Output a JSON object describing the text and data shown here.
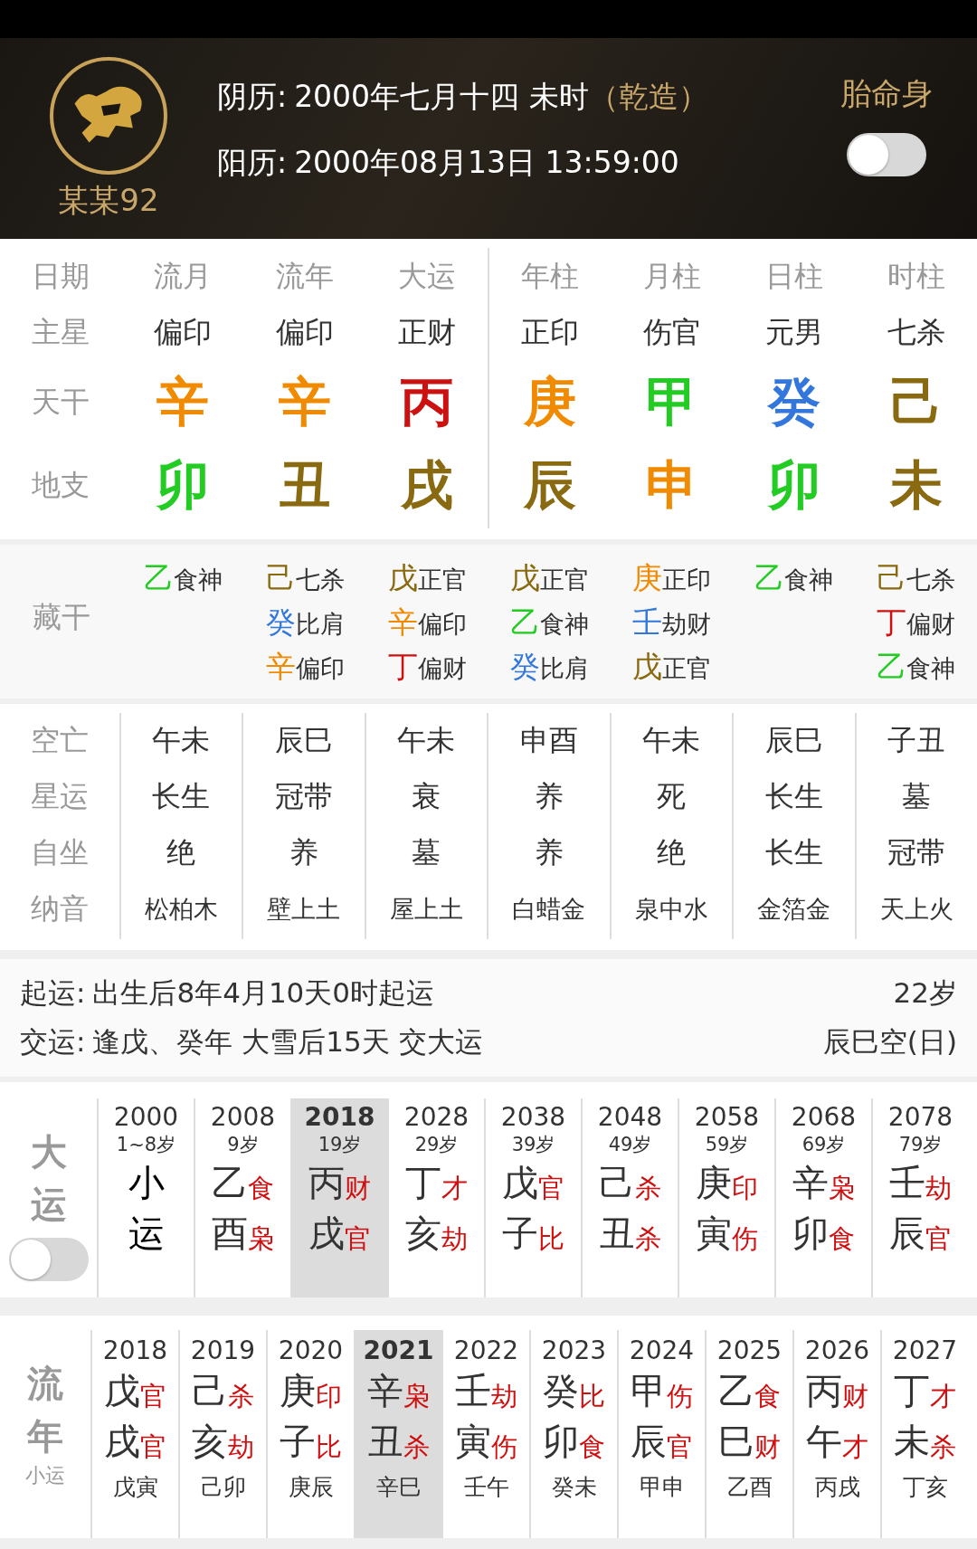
{
  "profile": {
    "name": "某某92"
  },
  "birth": [
    {
      "label": "阴历:",
      "value": "2000年七月十四 未时",
      "tag": "（乾造）"
    },
    {
      "label": "阳历:",
      "value": "2000年08月13日 13:59:00"
    }
  ],
  "taimingshen": {
    "label": "胎命身",
    "on": false
  },
  "pillars": {
    "corner": "日期",
    "row_labels": [
      "主星",
      "天干",
      "地支"
    ],
    "columns": [
      {
        "title": "流月",
        "star": "偏印",
        "stem": {
          "text": "辛",
          "color": "#f08a00"
        },
        "branch": {
          "text": "卯",
          "color": "#22cc22"
        }
      },
      {
        "title": "流年",
        "star": "偏印",
        "stem": {
          "text": "辛",
          "color": "#f08a00"
        },
        "branch": {
          "text": "丑",
          "color": "#8a6a10"
        }
      },
      {
        "title": "大运",
        "star": "正财",
        "stem": {
          "text": "丙",
          "color": "#cc1111"
        },
        "branch": {
          "text": "戌",
          "color": "#8a6a10"
        }
      },
      {
        "title": "年柱",
        "star": "正印",
        "stem": {
          "text": "庚",
          "color": "#f08a00"
        },
        "branch": {
          "text": "辰",
          "color": "#8a6a10"
        }
      },
      {
        "title": "月柱",
        "star": "伤官",
        "stem": {
          "text": "甲",
          "color": "#22cc22"
        },
        "branch": {
          "text": "申",
          "color": "#f08a00"
        }
      },
      {
        "title": "日柱",
        "star": "元男",
        "stem": {
          "text": "癸",
          "color": "#3377dd"
        },
        "branch": {
          "text": "卯",
          "color": "#22cc22"
        }
      },
      {
        "title": "时柱",
        "star": "七杀",
        "stem": {
          "text": "己",
          "color": "#8a6a10"
        },
        "branch": {
          "text": "未",
          "color": "#8a6a10"
        }
      }
    ]
  },
  "canggan": {
    "label": "藏干",
    "columns": [
      [
        {
          "stem": "乙",
          "color": "#22cc22",
          "god": "食神"
        }
      ],
      [
        {
          "stem": "己",
          "color": "#8a6a10",
          "god": "七杀"
        },
        {
          "stem": "癸",
          "color": "#3377dd",
          "god": "比肩"
        },
        {
          "stem": "辛",
          "color": "#f08a00",
          "god": "偏印"
        }
      ],
      [
        {
          "stem": "戊",
          "color": "#8a6a10",
          "god": "正官"
        },
        {
          "stem": "辛",
          "color": "#f08a00",
          "god": "偏印"
        },
        {
          "stem": "丁",
          "color": "#cc1111",
          "god": "偏财"
        }
      ],
      [
        {
          "stem": "戊",
          "color": "#8a6a10",
          "god": "正官"
        },
        {
          "stem": "乙",
          "color": "#22cc22",
          "god": "食神"
        },
        {
          "stem": "癸",
          "color": "#3377dd",
          "god": "比肩"
        }
      ],
      [
        {
          "stem": "庚",
          "color": "#f08a00",
          "god": "正印"
        },
        {
          "stem": "壬",
          "color": "#3377dd",
          "god": "劫财"
        },
        {
          "stem": "戊",
          "color": "#8a6a10",
          "god": "正官"
        }
      ],
      [
        {
          "stem": "乙",
          "color": "#22cc22",
          "god": "食神"
        }
      ],
      [
        {
          "stem": "己",
          "color": "#8a6a10",
          "god": "七杀"
        },
        {
          "stem": "丁",
          "color": "#cc1111",
          "god": "偏财"
        },
        {
          "stem": "乙",
          "color": "#22cc22",
          "god": "食神"
        }
      ]
    ]
  },
  "details": {
    "rows": [
      {
        "label": "空亡",
        "values": [
          "午未",
          "辰巳",
          "午未",
          "申酉",
          "午未",
          "辰巳",
          "子丑"
        ]
      },
      {
        "label": "星运",
        "values": [
          "长生",
          "冠带",
          "衰",
          "养",
          "死",
          "长生",
          "墓"
        ]
      },
      {
        "label": "自坐",
        "values": [
          "绝",
          "养",
          "墓",
          "养",
          "绝",
          "长生",
          "冠带"
        ]
      },
      {
        "label": "纳音",
        "values": [
          "松柏木",
          "壁上土",
          "屋上土",
          "白蜡金",
          "泉中水",
          "金箔金",
          "天上火"
        ]
      }
    ]
  },
  "qiyun": [
    {
      "label": "起运:",
      "text": "出生后8年4月10天0时起运",
      "right": "22岁"
    },
    {
      "label": "交运:",
      "text": "逢戊、癸年 大雪后15天 交大运",
      "right": "辰巳空(日)"
    }
  ],
  "dayun": {
    "title": [
      "大",
      "运"
    ],
    "toggle": {
      "on": false
    },
    "items": [
      {
        "kind": "xiaoyun",
        "year": "2000",
        "age": "1~8岁",
        "stem": "小",
        "branch": "运",
        "selected": false
      },
      {
        "kind": "luck",
        "year": "2008",
        "age": "9岁",
        "stem": "乙",
        "stem_god": "食",
        "branch": "酉",
        "branch_god": "枭",
        "selected": false
      },
      {
        "kind": "luck",
        "year": "2018",
        "age": "19岁",
        "stem": "丙",
        "stem_god": "财",
        "branch": "戌",
        "branch_god": "官",
        "selected": true
      },
      {
        "kind": "luck",
        "year": "2028",
        "age": "29岁",
        "stem": "丁",
        "stem_god": "才",
        "branch": "亥",
        "branch_god": "劫",
        "selected": false
      },
      {
        "kind": "luck",
        "year": "2038",
        "age": "39岁",
        "stem": "戊",
        "stem_god": "官",
        "branch": "子",
        "branch_god": "比",
        "selected": false
      },
      {
        "kind": "luck",
        "year": "2048",
        "age": "49岁",
        "stem": "己",
        "stem_god": "杀",
        "branch": "丑",
        "branch_god": "杀",
        "selected": false
      },
      {
        "kind": "luck",
        "year": "2058",
        "age": "59岁",
        "stem": "庚",
        "stem_god": "印",
        "branch": "寅",
        "branch_god": "伤",
        "selected": false
      },
      {
        "kind": "luck",
        "year": "2068",
        "age": "69岁",
        "stem": "辛",
        "stem_god": "枭",
        "branch": "卯",
        "branch_god": "食",
        "selected": false
      },
      {
        "kind": "luck",
        "year": "2078",
        "age": "79岁",
        "stem": "壬",
        "stem_god": "劫",
        "branch": "辰",
        "branch_god": "官",
        "selected": false
      }
    ]
  },
  "liunian": {
    "title": [
      "流",
      "年"
    ],
    "subtitle": "小运",
    "items": [
      {
        "year": "2018",
        "stem": "戊",
        "stem_god": "官",
        "branch": "戌",
        "branch_god": "官",
        "xiaoyun": "戊寅",
        "selected": false
      },
      {
        "year": "2019",
        "stem": "己",
        "stem_god": "杀",
        "branch": "亥",
        "branch_god": "劫",
        "xiaoyun": "己卯",
        "selected": false
      },
      {
        "year": "2020",
        "stem": "庚",
        "stem_god": "印",
        "branch": "子",
        "branch_god": "比",
        "xiaoyun": "庚辰",
        "selected": false
      },
      {
        "year": "2021",
        "stem": "辛",
        "stem_god": "枭",
        "branch": "丑",
        "branch_god": "杀",
        "xiaoyun": "辛巳",
        "selected": true
      },
      {
        "year": "2022",
        "stem": "壬",
        "stem_god": "劫",
        "branch": "寅",
        "branch_god": "伤",
        "xiaoyun": "壬午",
        "selected": false
      },
      {
        "year": "2023",
        "stem": "癸",
        "stem_god": "比",
        "branch": "卯",
        "branch_god": "食",
        "xiaoyun": "癸未",
        "selected": false
      },
      {
        "year": "2024",
        "stem": "甲",
        "stem_god": "伤",
        "branch": "辰",
        "branch_god": "官",
        "xiaoyun": "甲申",
        "selected": false
      },
      {
        "year": "2025",
        "stem": "乙",
        "stem_god": "食",
        "branch": "巳",
        "branch_god": "财",
        "xiaoyun": "乙酉",
        "selected": false
      },
      {
        "year": "2026",
        "stem": "丙",
        "stem_god": "财",
        "branch": "午",
        "branch_god": "才",
        "xiaoyun": "丙戌",
        "selected": false
      },
      {
        "year": "2027",
        "stem": "丁",
        "stem_god": "才",
        "branch": "未",
        "branch_god": "杀",
        "xiaoyun": "丁亥",
        "selected": false
      }
    ]
  }
}
